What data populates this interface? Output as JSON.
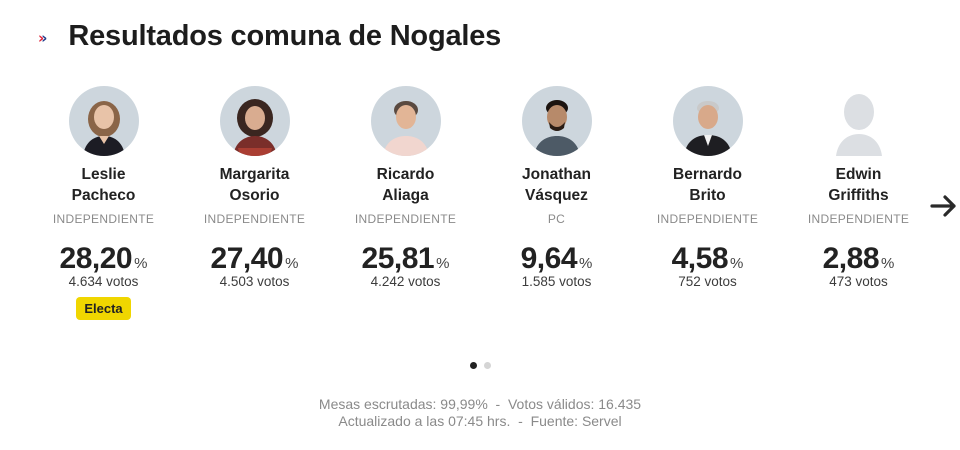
{
  "header": {
    "title": "Resultados comuna de Nogales",
    "chevron_icon": "double-chevron-right-icon"
  },
  "accent_colors": {
    "chevron_primary": "#e0243a",
    "chevron_secondary": "#1e3a8a",
    "badge": "#f0d600"
  },
  "candidates": [
    {
      "first": "Leslie",
      "last": "Pacheco",
      "party": "INDEPENDIENTE",
      "pct": "28,20",
      "pct_sign": "%",
      "votes": "4.634 votos",
      "badge": "Electa"
    },
    {
      "first": "Margarita",
      "last": "Osorio",
      "party": "INDEPENDIENTE",
      "pct": "27,40",
      "pct_sign": "%",
      "votes": "4.503 votos"
    },
    {
      "first": "Ricardo",
      "last": "Aliaga",
      "party": "INDEPENDIENTE",
      "pct": "25,81",
      "pct_sign": "%",
      "votes": "4.242 votos"
    },
    {
      "first": "Jonathan",
      "last": "Vásquez",
      "party": "PC",
      "pct": "9,64",
      "pct_sign": "%",
      "votes": "1.585 votos"
    },
    {
      "first": "Bernardo",
      "last": "Brito",
      "party": "INDEPENDIENTE",
      "pct": "4,58",
      "pct_sign": "%",
      "votes": "752 votos"
    },
    {
      "first": "Edwin",
      "last": "Griffiths",
      "party": "INDEPENDIENTE",
      "pct": "2,88",
      "pct_sign": "%",
      "votes": "473 votos"
    }
  ],
  "carousel": {
    "next_icon": "arrow-right-icon",
    "pages": 2,
    "active_page": 1
  },
  "footer": {
    "line1": "Mesas escrutadas: 99,99%  -  Votos válidos: 16.435",
    "line2": "Actualizado a las 07:45 hrs.  -  Fuente: Servel"
  }
}
